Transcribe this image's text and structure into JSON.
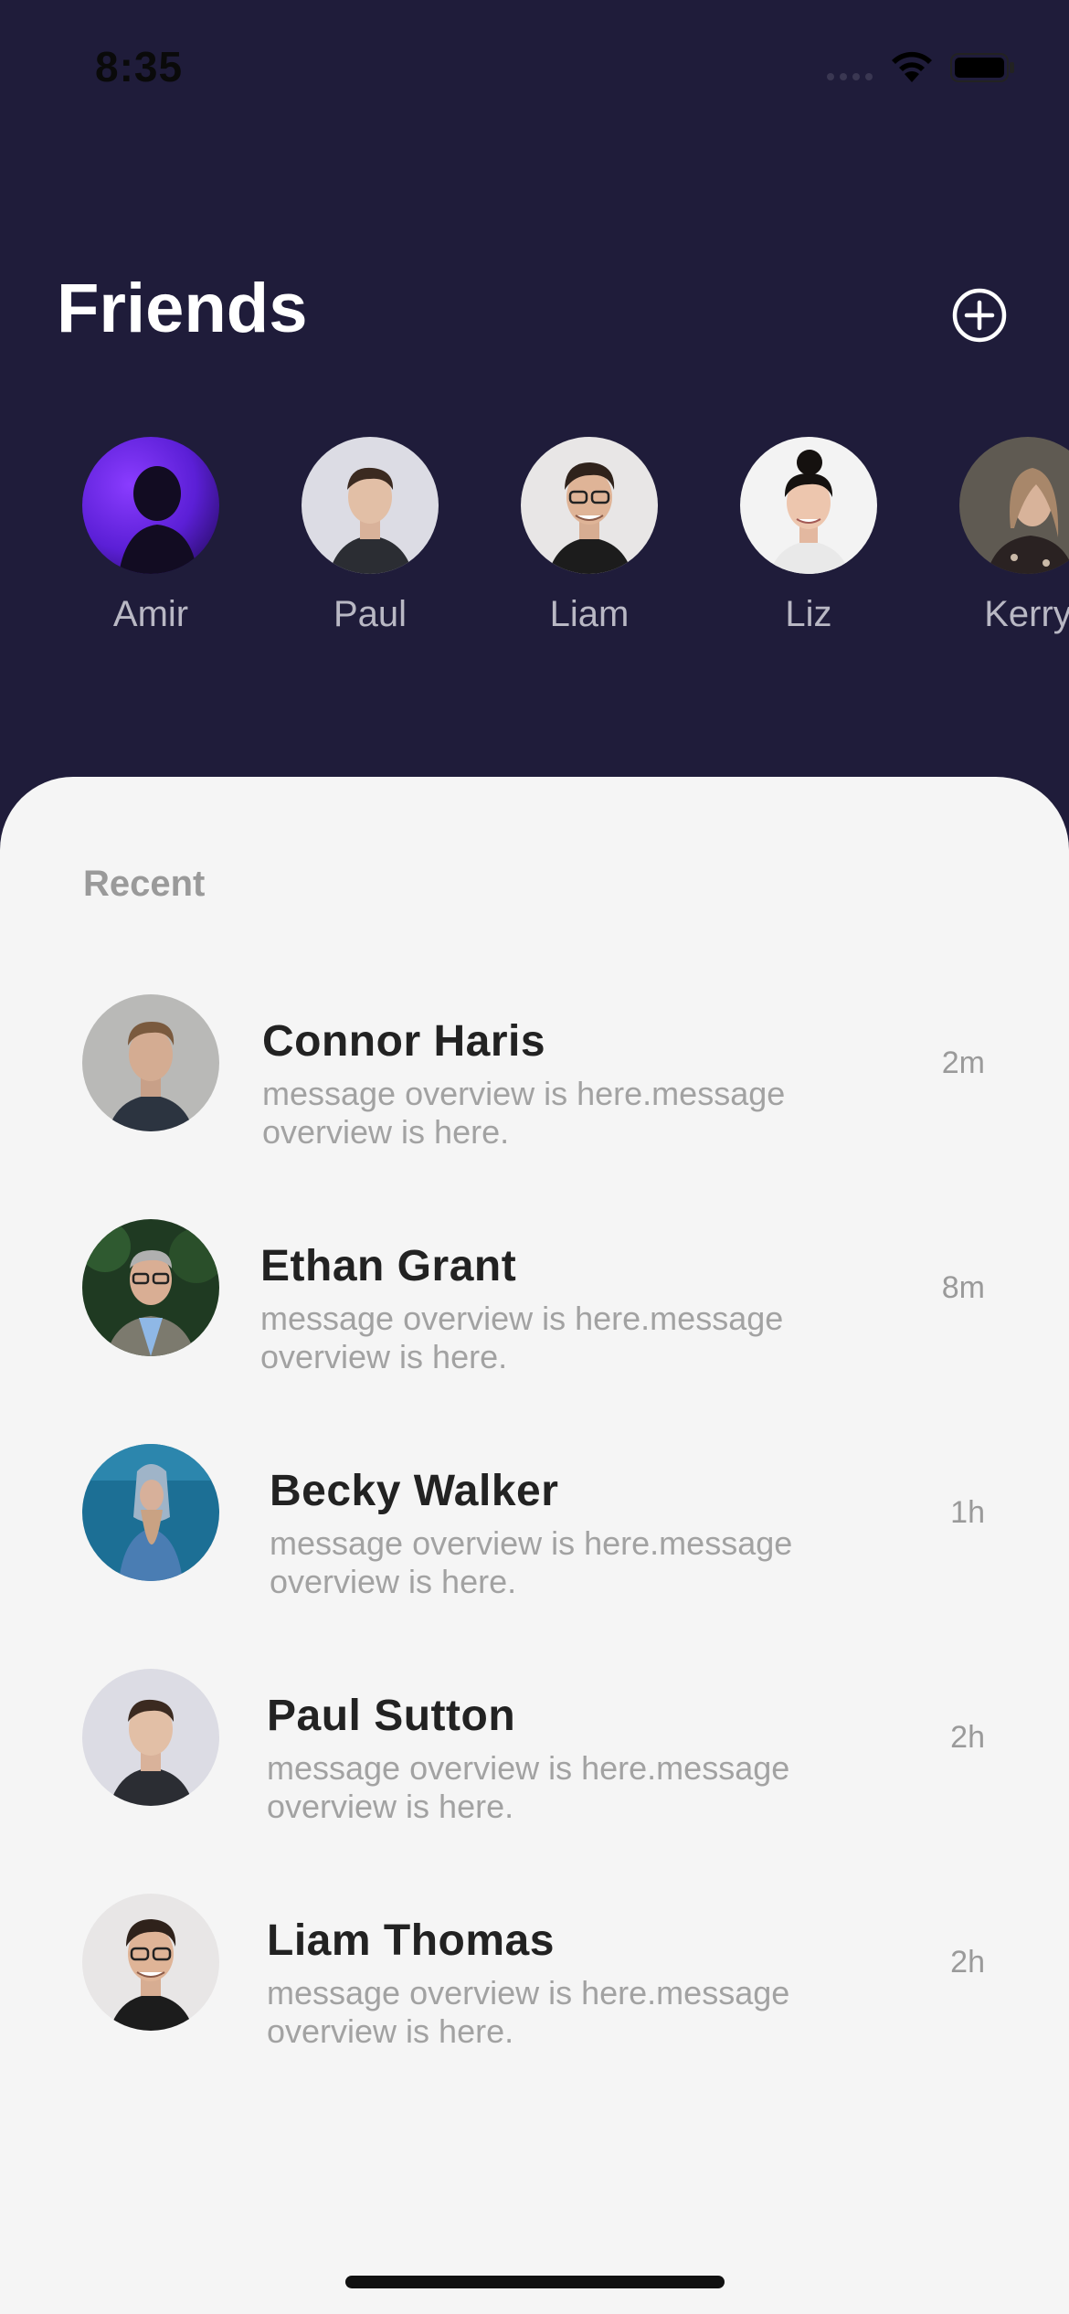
{
  "status_bar": {
    "time": "8:35",
    "icons": [
      "cellular-signal-icon",
      "wifi-icon",
      "battery-icon"
    ]
  },
  "header": {
    "title": "Friends",
    "add_button_icon": "plus-circle-icon"
  },
  "friends": [
    {
      "name": "Amir",
      "avatar": "silhouette-purple"
    },
    {
      "name": "Paul",
      "avatar": "photo-light"
    },
    {
      "name": "Liam",
      "avatar": "photo-light"
    },
    {
      "name": "Liz",
      "avatar": "photo-white"
    },
    {
      "name": "Kerry",
      "avatar": "photo-dark"
    }
  ],
  "recent": {
    "label": "Recent",
    "conversations": [
      {
        "name": "Connor Haris",
        "preview": "message overview is here.message overview is here.",
        "time": "2m"
      },
      {
        "name": "Ethan Grant",
        "preview": "message overview is here.message overview is here.",
        "time": "8m"
      },
      {
        "name": "Becky Walker",
        "preview": "message overview is here.message overview is here.",
        "time": "1h"
      },
      {
        "name": "Paul Sutton",
        "preview": "message overview is here.message overview is here.",
        "time": "2h"
      },
      {
        "name": "Liam Thomas",
        "preview": "message overview is here.message overview is here.",
        "time": "2h"
      }
    ]
  },
  "colors": {
    "header_bg": "#1f1c3a",
    "panel_bg": "#f5f5f5",
    "title_text": "#ffffff",
    "name_text": "#222222",
    "muted_text": "#a2a2a2",
    "accent_purple": "#6b2cf5"
  }
}
